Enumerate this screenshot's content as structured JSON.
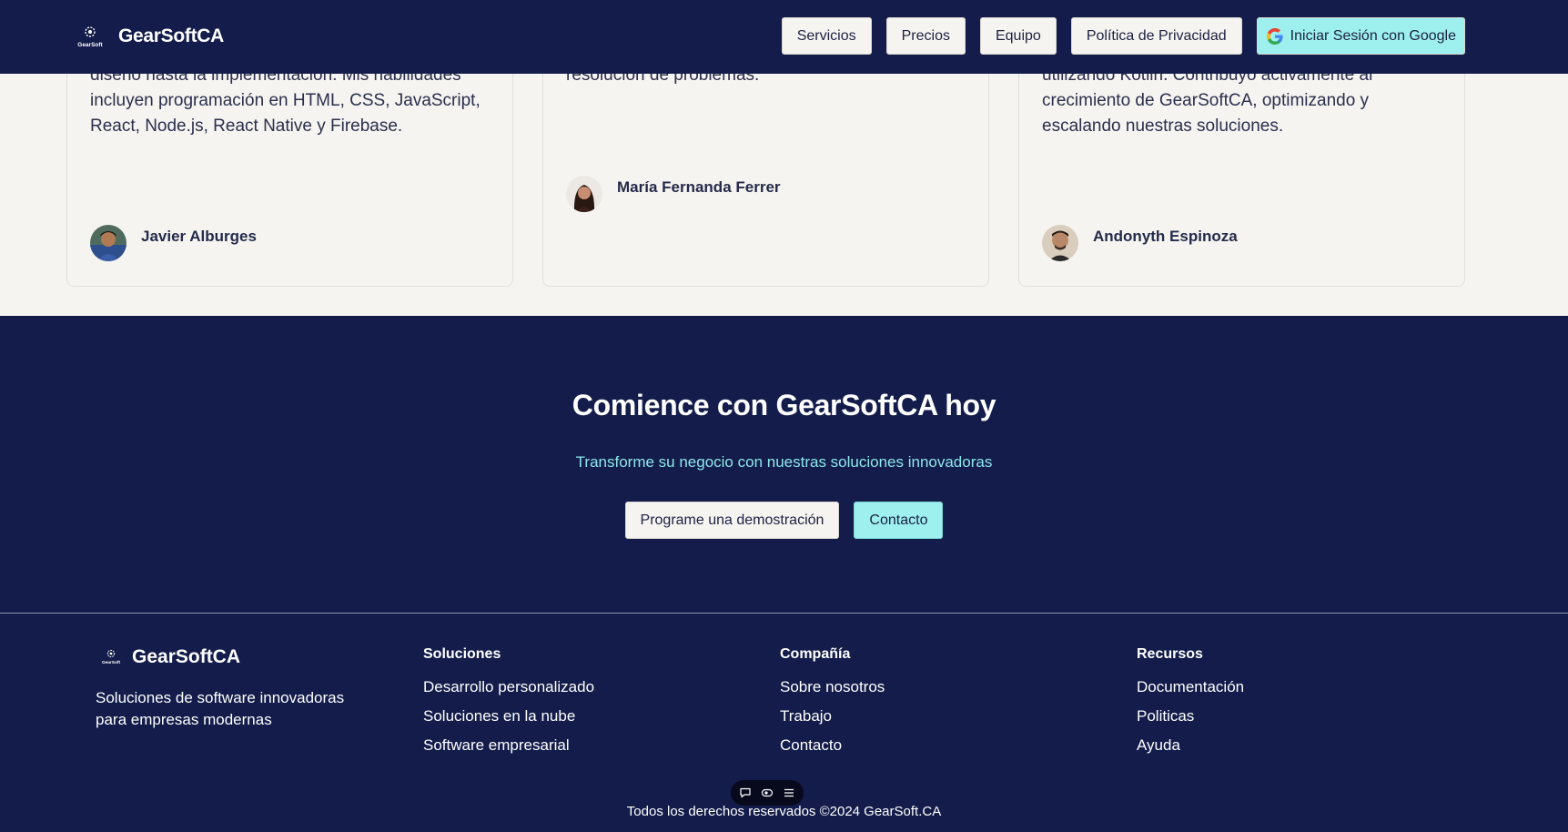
{
  "header": {
    "brand": "GearSoftCA",
    "logo_caption": "GearSoft",
    "nav": [
      "Servicios",
      "Precios",
      "Equipo",
      "Política de Privacidad"
    ],
    "google_signin": "Iniciar Sesión con Google"
  },
  "team": [
    {
      "text": "en desarrollo web y móvil. Experiencia en el ciclo de vida completo del desarrollo de software, desde el diseño hasta la implementación. Mis habilidades incluyen programación en HTML, CSS, JavaScript, React, Node.js, React Native y Firebase.",
      "name": "Javier Alburges"
    },
    {
      "text": "Centrado en crear experiencias de usuario significativas y atractivas a través del diseño y la resolución de problemas.",
      "name": "María Fernanda Ferrer"
    },
    {
      "text": "excepcionales. Experiencia en el diseño, desarrollo y mantenimiento de aplicaciones Android nativas utilizando Kotlin. Contribuyo activamente al crecimiento de GearSoftCA, optimizando y escalando nuestras soluciones.",
      "name": "Andonyth Espinoza"
    }
  ],
  "cta": {
    "title": "Comience con GearSoftCA hoy",
    "subtitle": "Transforme su negocio con nuestras soluciones innovadoras",
    "demo_button": "Programe una demostración",
    "contact_button": "Contacto"
  },
  "footer": {
    "brand": "GearSoftCA",
    "description": "Soluciones de software innovadoras para empresas modernas",
    "columns": [
      {
        "title": "Soluciones",
        "links": [
          "Desarrollo personalizado",
          "Soluciones en la nube",
          "Software empresarial"
        ]
      },
      {
        "title": "Compañía",
        "links": [
          "Sobre nosotros",
          "Trabajo",
          "Contacto"
        ]
      },
      {
        "title": "Recursos",
        "links": [
          "Documentación",
          "Politicas",
          "Ayuda"
        ]
      }
    ],
    "copyright": "Todos los derechos reservados ©2024 GearSoft.CA"
  },
  "colors": {
    "navy": "#131c4a",
    "accent_cyan": "#9df0ee",
    "subtitle_cyan": "#8ee7ea",
    "surface": "#f6f4f1"
  },
  "icons": [
    "gearsoft-logo-icon",
    "google-g-icon",
    "chat-bubble-icon",
    "eye-icon",
    "menu-icon"
  ]
}
